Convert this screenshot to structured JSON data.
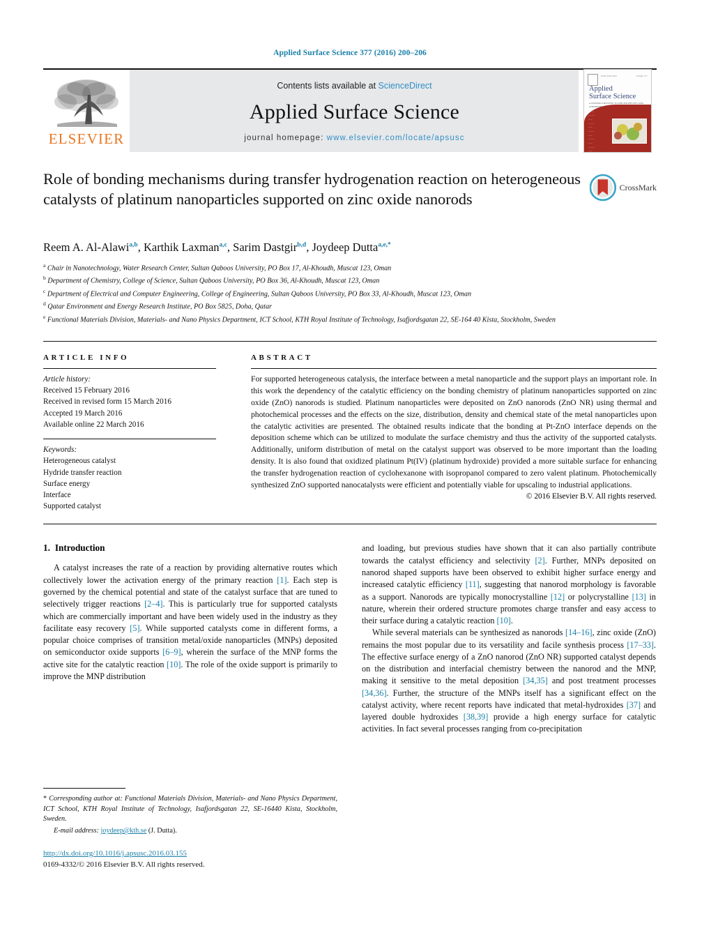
{
  "running_head": "Applied Surface Science 377 (2016) 200–206",
  "masthead": {
    "publisher_logo_label": "ELSEVIER",
    "contents_prefix": "Contents lists available at ",
    "contents_link": "ScienceDirect",
    "journal_name": "Applied Surface Science",
    "homepage_prefix": "journal homepage: ",
    "homepage_link": "www.elsevier.com/locate/apsusc",
    "cover": {
      "title_line1": "Applied",
      "title_line2": "Surface Science",
      "subtitle": "A JOURNAL DEVOTED TO APPLIED PHYSICS AND CHEMISTRY OF SURFACES AND INTERFACES",
      "corner_left": "ISSN 0169-4332",
      "corner_right": "Volume 377"
    }
  },
  "article": {
    "title": "Role of bonding mechanisms during transfer hydrogenation reaction on heterogeneous catalysts of platinum nanoparticles supported on zinc oxide nanorods",
    "crossmark_label": "CrossMark",
    "authors": [
      {
        "name": "Reem A. Al-Alawi",
        "marks": "a,b",
        "sep": ", "
      },
      {
        "name": "Karthik Laxman",
        "marks": "a,c",
        "sep": ", "
      },
      {
        "name": "Sarim Dastgir",
        "marks": "b,d",
        "sep": ", "
      },
      {
        "name": "Joydeep Dutta",
        "marks": "a,e,",
        "star": "*",
        "sep": ""
      }
    ],
    "affiliations": [
      {
        "mark": "a",
        "text": "Chair in Nanotechnology, Water Research Center, Sultan Qaboos University, PO Box 17, Al-Khoudh, Muscat 123, Oman"
      },
      {
        "mark": "b",
        "text": "Department of Chemistry, College of Science, Sultan Qaboos University, PO Box 36, Al-Khoudh, Muscat 123, Oman"
      },
      {
        "mark": "c",
        "text": "Department of Electrical and Computer Engineering, College of Engineering, Sultan Qaboos University, PO Box 33, Al-Khoudh, Muscat 123, Oman"
      },
      {
        "mark": "d",
        "text": "Qatar Environment and Energy Research Institute, PO Box 5825, Doha, Qatar"
      },
      {
        "mark": "e",
        "text": "Functional Materials Division, Materials- and Nano Physics Department, ICT School, KTH Royal Institute of Technology, Isafjordsgatan 22, SE-164 40 Kista, Stockholm, Sweden"
      }
    ]
  },
  "article_info": {
    "heading": "ARTICLE INFO",
    "history_label": "Article history:",
    "history": [
      "Received 15 February 2016",
      "Received in revised form 15 March 2016",
      "Accepted 19 March 2016",
      "Available online 22 March 2016"
    ],
    "keywords_label": "Keywords:",
    "keywords": [
      "Heterogeneous catalyst",
      "Hydride transfer reaction",
      "Surface energy",
      "Interface",
      "Supported catalyst"
    ]
  },
  "abstract": {
    "heading": "ABSTRACT",
    "text": "For supported heterogeneous catalysis, the interface between a metal nanoparticle and the support plays an important role. In this work the dependency of the catalytic efficiency on the bonding chemistry of platinum nanoparticles supported on zinc oxide (ZnO) nanorods is studied. Platinum nanoparticles were deposited on ZnO nanorods (ZnO NR) using thermal and photochemical processes and the effects on the size, distribution, density and chemical state of the metal nanoparticles upon the catalytic activities are presented. The obtained results indicate that the bonding at Pt-ZnO interface depends on the deposition scheme which can be utilized to modulate the surface chemistry and thus the activity of the supported catalysts. Additionally, uniform distribution of metal on the catalyst support was observed to be more important than the loading density. It is also found that oxidized platinum Pt(IV) (platinum hydroxide) provided a more suitable surface for enhancing the transfer hydrogenation reaction of cyclohexanone with isopropanol compared to zero valent platinum. Photochemically synthesized ZnO supported nanocatalysts were efficient and potentially viable for upscaling to industrial applications.",
    "copyright": "© 2016 Elsevier B.V. All rights reserved."
  },
  "introduction": {
    "number": "1.",
    "heading": "Introduction",
    "left_paragraph_parts": [
      {
        "t": "A catalyst increases the rate of a reaction by providing alternative routes which collectively lower the activation energy of the primary reaction "
      },
      {
        "r": "[1]"
      },
      {
        "t": ". Each step is governed by the chemical potential and state of the catalyst surface that are tuned to selectively trigger reactions "
      },
      {
        "r": "[2–4]"
      },
      {
        "t": ". This is particularly true for supported catalysts which are commercially important and have been widely used in the industry as they facilitate easy recovery "
      },
      {
        "r": "[5]"
      },
      {
        "t": ". While supported catalysts come in different forms, a popular choice comprises of transition metal/oxide nanoparticles (MNPs) deposited on semiconductor oxide supports "
      },
      {
        "r": "[6–9]"
      },
      {
        "t": ", wherein the surface of the MNP forms the active site for the catalytic reaction "
      },
      {
        "r": "[10]"
      },
      {
        "t": ". The role of the oxide support is primarily to improve the MNP distribution"
      }
    ],
    "right_paragraph1_parts": [
      {
        "t": "and loading, but previous studies have shown that it can also partially contribute towards the catalyst efficiency and selectivity "
      },
      {
        "r": "[2]"
      },
      {
        "t": ". Further, MNPs deposited on nanorod shaped supports have been observed to exhibit higher surface energy and increased catalytic efficiency "
      },
      {
        "r": "[11]"
      },
      {
        "t": ", suggesting that nanorod morphology is favorable as a support. Nanorods are typically monocrystalline "
      },
      {
        "r": "[12]"
      },
      {
        "t": " or polycrystalline "
      },
      {
        "r": "[13]"
      },
      {
        "t": " in nature, wherein their ordered structure promotes charge transfer and easy access to their surface during a catalytic reaction "
      },
      {
        "r": "[10]"
      },
      {
        "t": "."
      }
    ],
    "right_paragraph2_parts": [
      {
        "t": "While several materials can be synthesized as nanorods "
      },
      {
        "r": "[14–16]"
      },
      {
        "t": ", zinc oxide (ZnO) remains the most popular due to its versatility and facile synthesis process "
      },
      {
        "r": "[17–33]"
      },
      {
        "t": ". The effective surface energy of a ZnO nanorod (ZnO NR) supported catalyst depends on the distribution and interfacial chemistry between the nanorod and the MNP, making it sensitive to the metal deposition "
      },
      {
        "r": "[34,35]"
      },
      {
        "t": " and post treatment processes "
      },
      {
        "r": "[34,36]"
      },
      {
        "t": ". Further, the structure of the MNPs itself has a significant effect on the catalyst activity, where recent reports have indicated that metal-hydroxides "
      },
      {
        "r": "[37]"
      },
      {
        "t": " and layered double hydroxides "
      },
      {
        "r": "[38,39]"
      },
      {
        "t": " provide a high energy surface for catalytic activities. In fact several processes ranging from co-precipitation"
      }
    ]
  },
  "footnote": {
    "star": "*",
    "corresponding_text": "Corresponding author at: Functional Materials Division, Materials- and Nano Physics Department, ICT School, KTH Royal Institute of Technology, Isafjordsgatan 22, SE-16440 Kista, Stockholm, Sweden.",
    "email_label": "E-mail address:",
    "email": "joydeep@kth.se",
    "email_owner": "(J. Dutta).",
    "doi": "http://dx.doi.org/10.1016/j.apsusc.2016.03.155",
    "issn_line": "0169-4332/© 2016 Elsevier B.V. All rights reserved."
  },
  "colors": {
    "link": "#1a7fa8",
    "elsevier_orange": "#E87722",
    "masthead_gray": "#e7e8ea",
    "cover_red": "#a42a22"
  }
}
